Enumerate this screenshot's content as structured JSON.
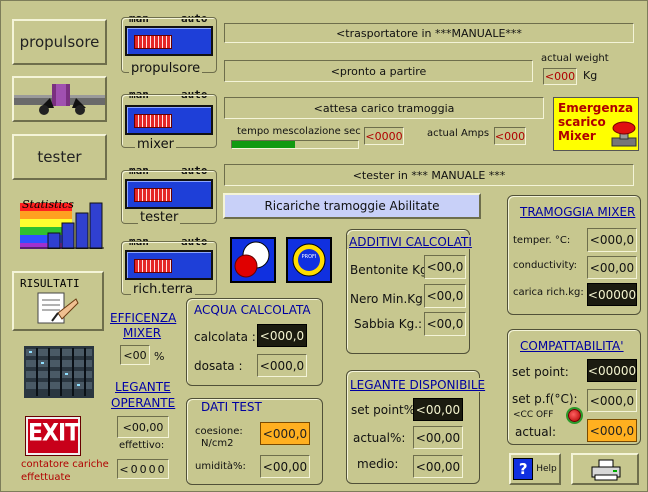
{
  "buttons": {
    "propulsore": "propulsore",
    "tester": "tester",
    "risultati": "RISULTATI",
    "exit": "EXIT",
    "help": "Help",
    "statistics": "Statistics",
    "ricariche": "Ricariche tramoggie Abilitate",
    "emergenza": [
      "Emergenza",
      "scarico",
      "Mixer"
    ]
  },
  "toggles": [
    {
      "man": "man",
      "auto": "auto",
      "label": "propulsore"
    },
    {
      "man": "man",
      "auto": "auto",
      "label": "mixer"
    },
    {
      "man": "man",
      "auto": "auto",
      "label": "tester"
    },
    {
      "man": "man",
      "auto": "auto",
      "label": "rich.terra"
    }
  ],
  "status": {
    "trasportatore": "<trasportatore in ***MANUALE***",
    "pronto": "<pronto a partire",
    "attesa": "<attesa carico tramoggia",
    "tester": "<tester in  *** MANUALE ***"
  },
  "weight": {
    "label": "actual weight",
    "value": "<000",
    "unit": "Kg"
  },
  "mescolazione": {
    "label": "tempo mescolazione sec",
    "value": "<0000",
    "progress": 0.5
  },
  "amps": {
    "label": "actual Amps",
    "value": "<000"
  },
  "efficienza": {
    "title1": "EFFICENZA",
    "title2": "MIXER",
    "value": "<00",
    "unit": "%"
  },
  "legante_operante": {
    "title1": "LEGANTE",
    "title2": "OPERANTE",
    "value": "<00,00",
    "effettivo_label": "effettivo:"
  },
  "contatore": {
    "label1": "contatore cariche",
    "label2": "effettuate",
    "value": "<0000"
  },
  "acqua": {
    "title": "ACQUA CALCOLATA",
    "calcolata_label": "calcolata :",
    "calcolata_value": "<000,0",
    "dosata_label": "dosata :",
    "dosata_value": "<000,0"
  },
  "dati_test": {
    "title": "DATI  TEST",
    "coesione_label1": "coesione:",
    "coesione_label2": "N/cm2",
    "coesione_value": "<000,0",
    "umidita_label": "umidità%:",
    "umidita_value": "<00,00"
  },
  "additivi": {
    "title": "ADDITIVI CALCOLATI",
    "rows": [
      {
        "label": "Bentonite Kg",
        "value": "<00,0"
      },
      {
        "label": "Nero Min.Kg",
        "value": "<00,0"
      },
      {
        "label": "Sabbia Kg.:",
        "value": "<00,0"
      }
    ]
  },
  "legante_disp": {
    "title": "LEGANTE DISPONIBILE",
    "rows": [
      {
        "label": "set point%",
        "value": "<00,00"
      },
      {
        "label": "actual%:",
        "value": "<00,00"
      },
      {
        "label": "medio:",
        "value": "<00,00"
      }
    ]
  },
  "tramoggia": {
    "title": "TRAMOGGIA MIXER",
    "rows": [
      {
        "label": "temper.   °C:",
        "value": "<000,0"
      },
      {
        "label": "conductivity:",
        "value": "<00,00"
      },
      {
        "label": "carica rich.kg:",
        "value": "<00000"
      }
    ]
  },
  "compatt": {
    "title": "COMPATTABILITA'",
    "set_point_label": "set point:",
    "set_point_value": "<00000",
    "setpf_label": "set p.f(°C):",
    "setpf_value": "<000,0",
    "cc_off": "<CC OFF",
    "actual_label": "actual:",
    "actual_value": "<000,0"
  },
  "colors": {
    "background": "#c7c78f",
    "toggle_blue": "#1e3fd8",
    "orange": "#ffb020",
    "emergency_yellow": "#ffff00"
  }
}
